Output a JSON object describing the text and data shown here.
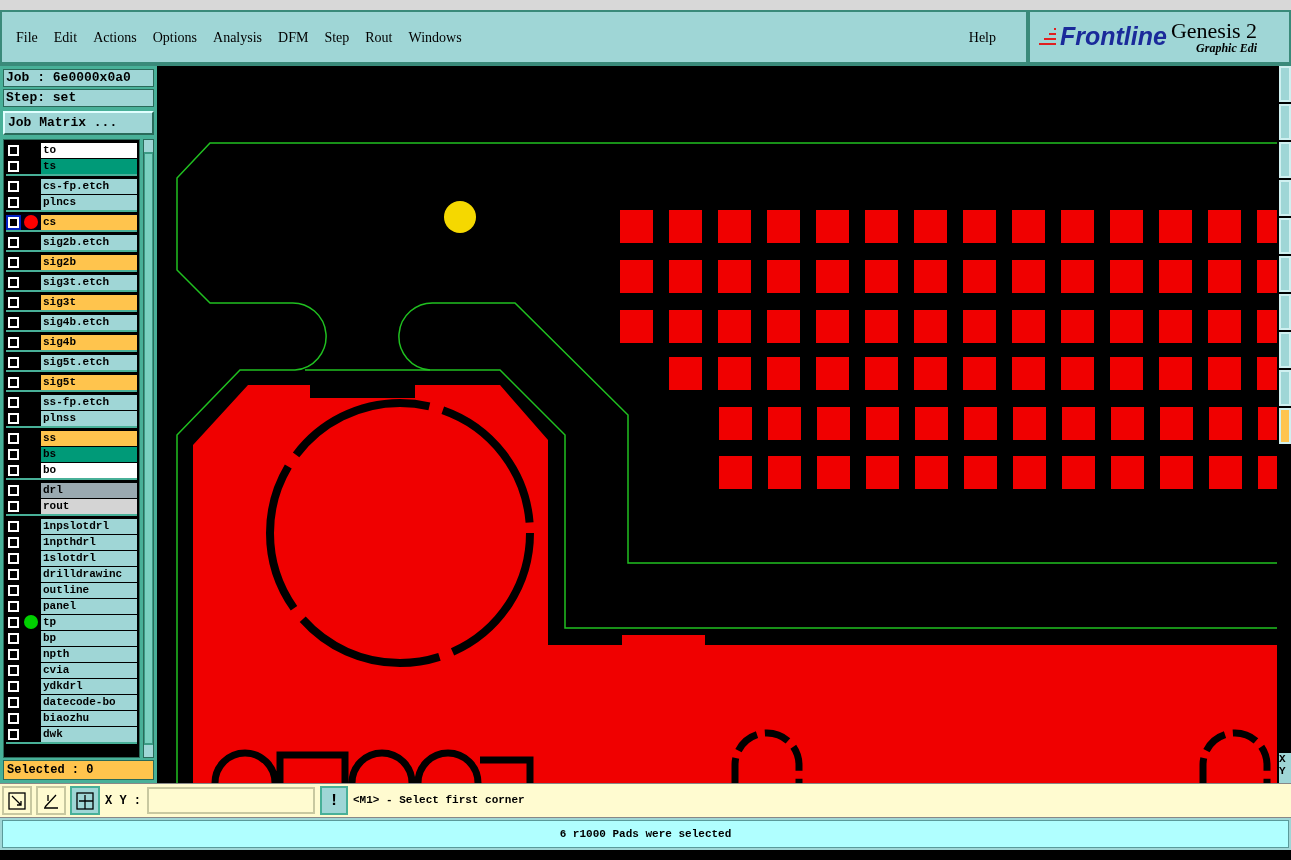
{
  "menu": [
    "File",
    "Edit",
    "Actions",
    "Options",
    "Analysis",
    "DFM",
    "Step",
    "Rout",
    "Windows"
  ],
  "help": "Help",
  "brand": {
    "logo": "Frontline",
    "product": "Genesis 2",
    "subtitle": "Graphic Edi"
  },
  "job": "Job : 6e0000x0a0",
  "step": "Step: set",
  "job_matrix": "Job Matrix ...",
  "layer_groups": [
    [
      {
        "name": "to",
        "kind": "silk",
        "work": false
      },
      {
        "name": "ts",
        "kind": "mask",
        "work": false
      }
    ],
    [
      {
        "name": "cs-fp.etch",
        "kind": "doc",
        "work": false
      },
      {
        "name": "plncs",
        "kind": "doc",
        "work": false
      }
    ],
    [
      {
        "name": "cs",
        "kind": "signal",
        "work": true,
        "color": "#ff0000"
      }
    ],
    [
      {
        "name": "sig2b.etch",
        "kind": "doc",
        "work": false
      }
    ],
    [
      {
        "name": "sig2b",
        "kind": "signal",
        "work": false
      }
    ],
    [
      {
        "name": "sig3t.etch",
        "kind": "doc",
        "work": false
      }
    ],
    [
      {
        "name": "sig3t",
        "kind": "signal",
        "work": false
      }
    ],
    [
      {
        "name": "sig4b.etch",
        "kind": "doc",
        "work": false
      }
    ],
    [
      {
        "name": "sig4b",
        "kind": "signal",
        "work": false
      }
    ],
    [
      {
        "name": "sig5t.etch",
        "kind": "doc",
        "work": false
      }
    ],
    [
      {
        "name": "sig5t",
        "kind": "signal",
        "work": false
      }
    ],
    [
      {
        "name": "ss-fp.etch",
        "kind": "doc",
        "work": false
      },
      {
        "name": "plnss",
        "kind": "doc",
        "work": false
      }
    ],
    [
      {
        "name": "ss",
        "kind": "signal",
        "work": false
      },
      {
        "name": "bs",
        "kind": "mask",
        "work": false
      },
      {
        "name": "bo",
        "kind": "silk",
        "work": false
      }
    ],
    [
      {
        "name": "drl",
        "kind": "drill",
        "work": false
      },
      {
        "name": "rout",
        "kind": "rout",
        "work": false
      }
    ],
    [
      {
        "name": "1npslotdrl",
        "kind": "doc",
        "work": false
      },
      {
        "name": "1npthdrl",
        "kind": "doc",
        "work": false
      },
      {
        "name": "1slotdrl",
        "kind": "doc",
        "work": false
      },
      {
        "name": "drilldrawinc",
        "kind": "doc",
        "work": false
      },
      {
        "name": "outline",
        "kind": "doc",
        "work": false
      },
      {
        "name": "panel",
        "kind": "doc",
        "work": false
      },
      {
        "name": "tp",
        "kind": "doc",
        "work": false,
        "color": "#00d000"
      },
      {
        "name": "bp",
        "kind": "doc",
        "work": false
      },
      {
        "name": "npth",
        "kind": "doc",
        "work": false
      },
      {
        "name": "cvia",
        "kind": "doc",
        "work": false
      },
      {
        "name": "ydkdrl",
        "kind": "doc",
        "work": false
      },
      {
        "name": "datecode-bo",
        "kind": "doc",
        "work": false
      },
      {
        "name": "biaozhu",
        "kind": "doc",
        "work": false
      },
      {
        "name": "dwk",
        "kind": "doc",
        "work": false
      }
    ]
  ],
  "selected": "Selected : 0",
  "coord_labels": [
    "X",
    "Y"
  ],
  "xy_label": "X Y :",
  "prompt_button": "!",
  "prompt": "<M1> - Select first corner",
  "status": "6 r1000 Pads were selected"
}
